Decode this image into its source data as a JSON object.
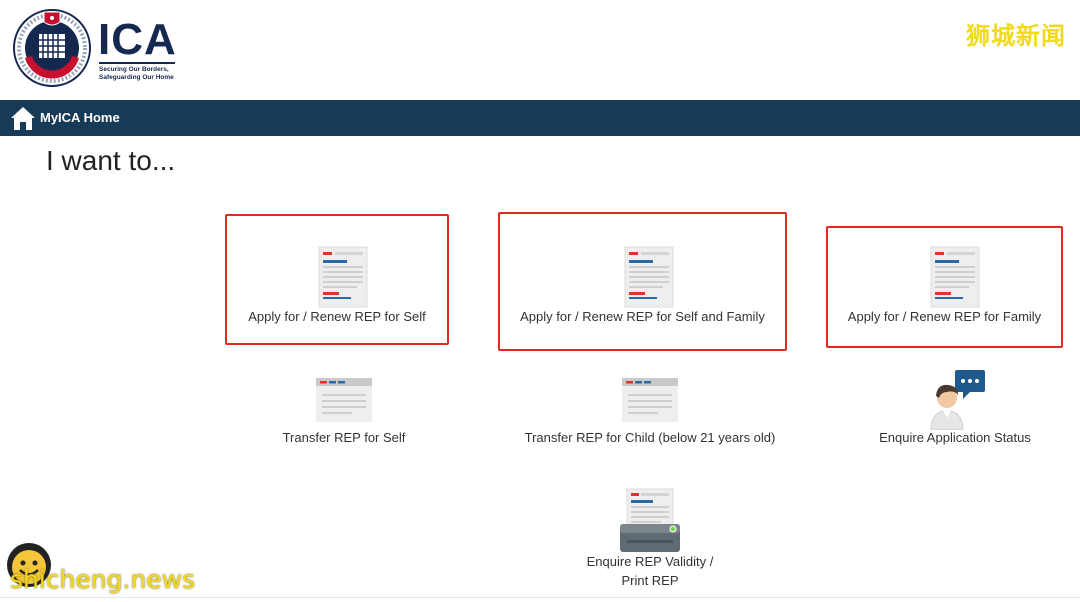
{
  "header": {
    "logo_text": "ICA",
    "logo_tagline": "Securing Our Borders, Safeguarding Our Home",
    "watermark_top": "狮城新闻"
  },
  "nav": {
    "home_label": "MyICA Home"
  },
  "page": {
    "title": "I want to..."
  },
  "tiles": [
    {
      "label": "Apply for / Renew REP for Self",
      "icon": "document-icon",
      "highlighted": true
    },
    {
      "label": "Apply for / Renew REP for Self and Family",
      "icon": "document-icon",
      "highlighted": true
    },
    {
      "label": "Apply for / Renew REP for Family",
      "icon": "document-icon",
      "highlighted": true
    },
    {
      "label": "Transfer REP for Self",
      "icon": "browser-window-icon",
      "highlighted": false
    },
    {
      "label": "Transfer REP for Child (below 21 years old)",
      "icon": "browser-window-icon",
      "highlighted": false
    },
    {
      "label": "Enquire Application Status",
      "icon": "person-chat-icon",
      "highlighted": false
    },
    {
      "label_line1": "Enquire REP Validity /",
      "label_line2": "Print REP",
      "icon": "printer-icon",
      "highlighted": false
    }
  ],
  "watermark_bottom": "shicheng.news",
  "colors": {
    "navbar": "#173a57",
    "highlight": "#e02b20",
    "brand": "#15284f",
    "watermark": "#f2d91c"
  }
}
